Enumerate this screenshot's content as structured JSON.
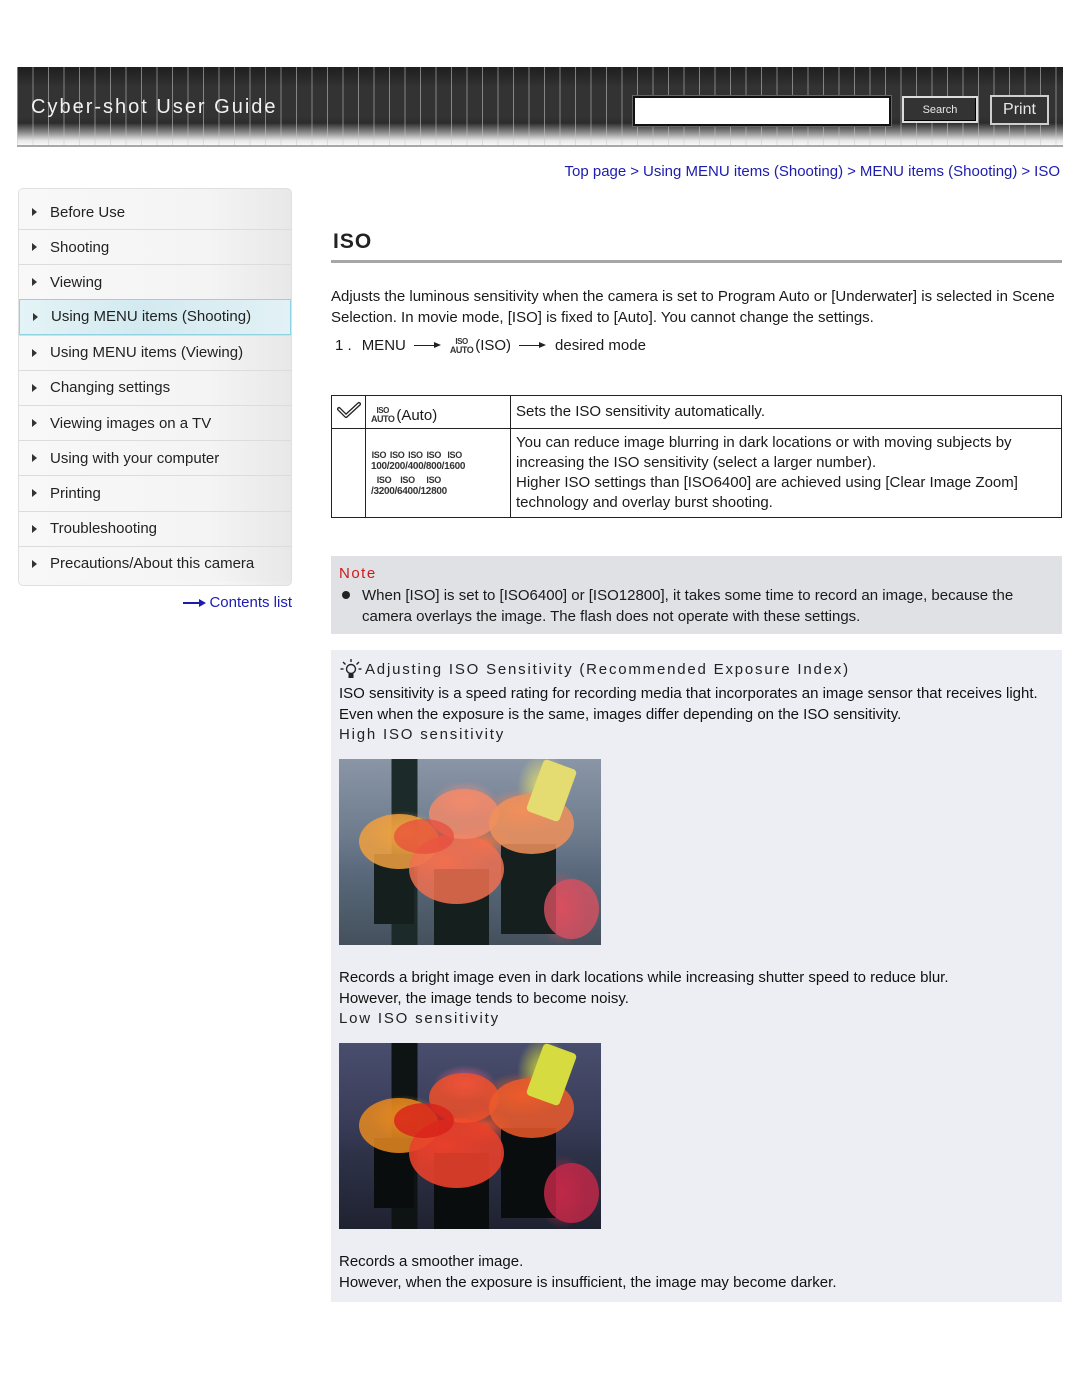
{
  "header": {
    "site_title": "Cyber-shot User Guide",
    "search_value": "",
    "search_button": "Search",
    "print_button": "Print"
  },
  "breadcrumb": {
    "items": [
      "Top page",
      "Using MENU items (Shooting)",
      "MENU items (Shooting)",
      "ISO"
    ],
    "separator": ">"
  },
  "sidebar": {
    "items": [
      {
        "label": "Before Use",
        "active": false
      },
      {
        "label": "Shooting",
        "active": false
      },
      {
        "label": "Viewing",
        "active": false
      },
      {
        "label": "Using MENU items (Shooting)",
        "active": true
      },
      {
        "label": "Using MENU items (Viewing)",
        "active": false
      },
      {
        "label": "Changing settings",
        "active": false
      },
      {
        "label": "Viewing images on a TV",
        "active": false
      },
      {
        "label": "Using with your computer",
        "active": false
      },
      {
        "label": "Printing",
        "active": false
      },
      {
        "label": "Troubleshooting",
        "active": false
      },
      {
        "label": "Precautions/About this camera",
        "active": false
      }
    ],
    "contents_link": "Contents list"
  },
  "main": {
    "title": "ISO",
    "intro": "Adjusts the luminous sensitivity when the camera is set to Program Auto or [Underwater] is selected in Scene Selection. In movie mode, [ISO] is fixed to [Auto]. You cannot change the settings.",
    "step": {
      "number": "1 .",
      "menu": "MENU",
      "icon_top": "ISO",
      "icon_bottom": "AUTO",
      "iso_label": "(ISO)",
      "target": "desired mode"
    },
    "table": {
      "row1": {
        "icon_top": "ISO",
        "icon_bottom": "AUTO",
        "label": "(Auto)",
        "description": "Sets the ISO sensitivity automatically."
      },
      "row2": {
        "iso_values_line1": [
          "100",
          "200",
          "400",
          "800",
          "1600"
        ],
        "iso_values_line2": [
          "3200",
          "6400",
          "12800"
        ],
        "iso_prefix": "ISO",
        "description_1": "You can reduce image blurring in dark locations or with moving subjects by increasing the ISO sensitivity (select a larger number).",
        "description_2": "Higher ISO settings than [ISO6400] are achieved using [Clear Image Zoom] technology and overlay burst shooting."
      }
    },
    "note": {
      "title": "Note",
      "items": [
        "When [ISO] is set to [ISO6400] or [ISO12800], it takes some time to record an image, because the camera overlays the image. The flash does not operate with these settings."
      ]
    },
    "hint": {
      "title": "Adjusting ISO Sensitivity (Recommended Exposure Index)",
      "text": "ISO sensitivity is a speed rating for recording media that incorporates an image sensor that receives light. Even when the exposure is the same, images differ depending on the ISO sensitivity.",
      "high_heading": "High ISO sensitivity",
      "high_text_1": "Records a bright image even in dark locations while increasing shutter speed to reduce blur.",
      "high_text_2": "However, the image tends to become noisy.",
      "low_heading": "Low ISO sensitivity",
      "low_text_1": "Records a smoother image.",
      "low_text_2": "However, when the exposure is insufficient, the image may become darker."
    }
  },
  "colors": {
    "link": "#1c1cb0",
    "note_title": "#cc1a1a",
    "note_bg": "#dfe1e5",
    "hint_bg": "#eceef3",
    "active_sidebar": "#d3eaf0"
  }
}
